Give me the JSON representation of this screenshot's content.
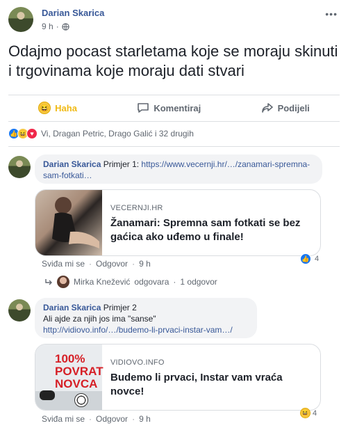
{
  "post": {
    "author": "Darian Skarica",
    "time": "9 h",
    "privacy_separator": "·",
    "text": "Odajmo pocast starletama koje se moraju skinuti i trgovinama koje moraju dati stvari"
  },
  "actions": {
    "haha": "Haha",
    "comment": "Komentiraj",
    "share": "Podijeli"
  },
  "reactions": {
    "summary": "Vi, Dragan Petric, Drago Galić i 32 drugih",
    "types": [
      "like-icon",
      "haha-icon",
      "love-icon"
    ]
  },
  "comments": [
    {
      "author": "Darian Skarica",
      "text": "Primjer 1:",
      "link": "https://www.vecernji.hr/…/zanamari-spremna-sam-fotkati…",
      "card": {
        "domain": "VECERNJI.HR",
        "headline": "Žanamari: Spremna sam fotkati se bez gaćica ako uđemo u finale!"
      },
      "like_label": "Sviđa mi se",
      "reply_label": "Odgovor",
      "time": "9 h",
      "reaction_count": "4",
      "reply_summary": {
        "name": "Mirka Knežević",
        "verb": "odgovara",
        "count": "1 odgovor"
      }
    },
    {
      "author": "Darian Skarica",
      "text": "Primjer 2",
      "text2": "Ali ajde za njih jos ima \"sanse\"",
      "link": "http://vidiovo.info/…/budemo-li-prvaci-instar-vam…/",
      "card": {
        "domain": "VIDIOVO.INFO",
        "headline": "Budemo li prvaci, Instar vam vraća novce!",
        "thumb_text": [
          "100%",
          "POVRAT",
          "NOVCA"
        ]
      },
      "like_label": "Sviđa mi se",
      "reply_label": "Odgovor",
      "time": "9 h",
      "reaction_count": "4"
    }
  ],
  "colors": {
    "link": "#385898",
    "haha_active": "#f0ba15",
    "like_blue": "#1877f2",
    "love_red": "#f0284a",
    "bubble_bg": "#f2f3f5"
  }
}
